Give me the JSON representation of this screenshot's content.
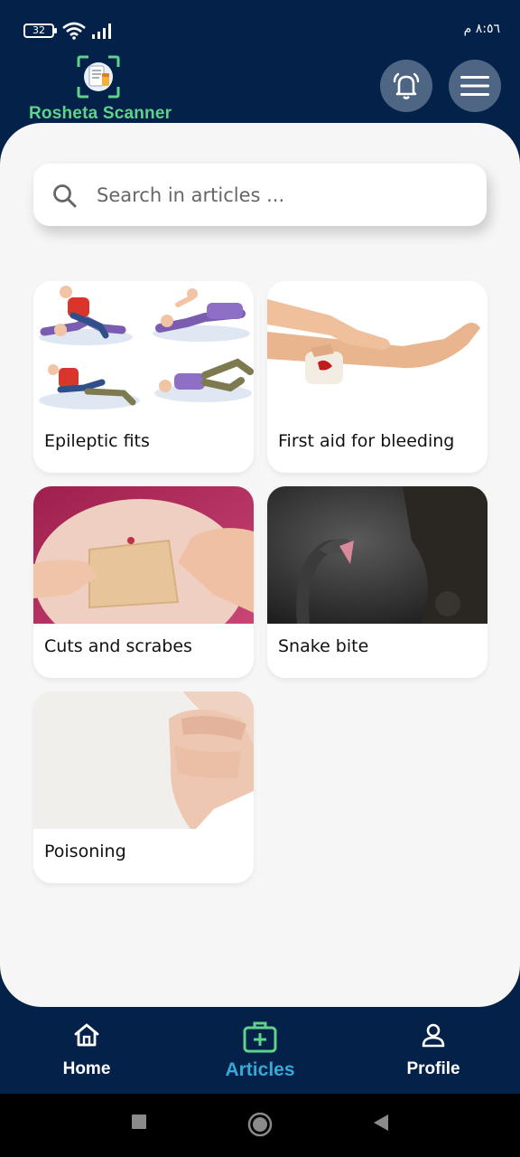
{
  "status_bar": {
    "battery": "32",
    "time": "٨:٥٦ م"
  },
  "header": {
    "app_name": "Rosheta Scanner",
    "bell_icon": "bell-ring-icon",
    "menu_icon": "hamburger-menu-icon"
  },
  "search": {
    "placeholder": "Search in articles ...",
    "icon": "search-icon"
  },
  "articles": [
    {
      "title": "Epileptic fits"
    },
    {
      "title": "First aid for bleeding"
    },
    {
      "title": "Cuts and scrabes"
    },
    {
      "title": "Snake bite"
    },
    {
      "title": "Poisoning"
    }
  ],
  "bottom_nav": {
    "items": [
      {
        "label": "Home",
        "icon": "home-icon"
      },
      {
        "label": "Articles",
        "icon": "medical-kit-icon",
        "active": true
      },
      {
        "label": "Profile",
        "icon": "user-icon"
      }
    ]
  },
  "colors": {
    "primary": "#04214a",
    "accent": "#36a9d6",
    "brand_green": "#5fd38a",
    "surface": "#f6f6f6"
  }
}
